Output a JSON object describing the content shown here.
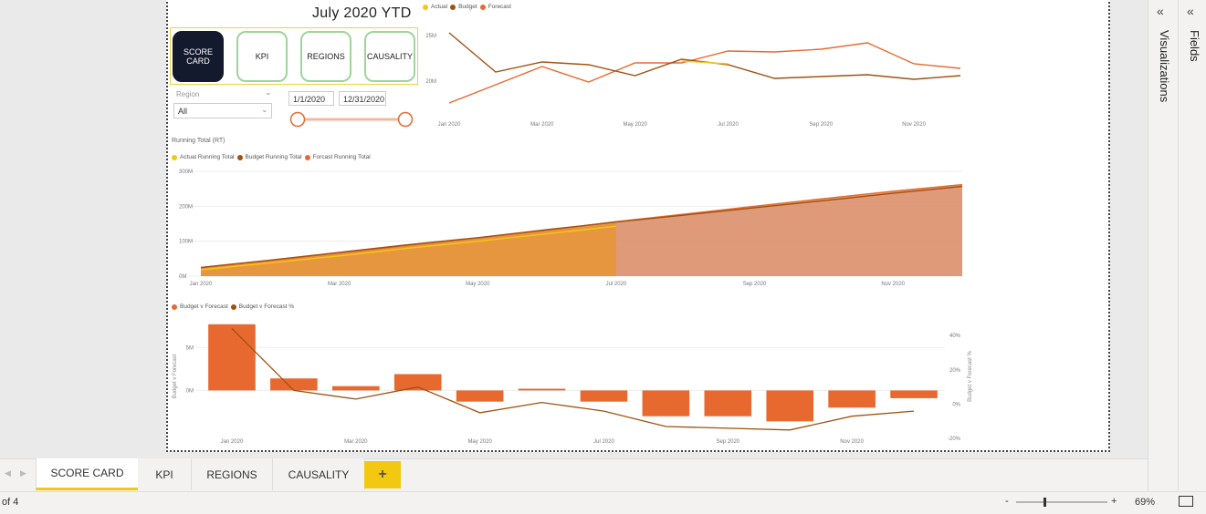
{
  "report": {
    "title": "July 2020 YTD",
    "nav_buttons": [
      {
        "label": "SCORE CARD",
        "active": true
      },
      {
        "label": "KPI",
        "active": false
      },
      {
        "label": "REGIONS",
        "active": false
      },
      {
        "label": "CAUSALITY",
        "active": false
      }
    ],
    "region_slicer": {
      "label": "Region",
      "value": "All"
    },
    "date_slicer": {
      "start": "1/1/2020",
      "end": "12/31/2020"
    }
  },
  "chart_data": [
    {
      "type": "line",
      "legend": [
        "Actual",
        "Budget",
        "Forecast"
      ],
      "x": [
        "Jan 2020",
        "Feb 2020",
        "Mar 2020",
        "Apr 2020",
        "May 2020",
        "Jun 2020",
        "Jul 2020",
        "Aug 2020",
        "Sep 2020",
        "Oct 2020",
        "Nov 2020",
        "Dec 2020"
      ],
      "x_tick_labels": [
        "Jan 2020",
        "Mar 2020",
        "May 2020",
        "Jul 2020",
        "Sep 2020",
        "Nov 2020"
      ],
      "y_tick_labels": [
        "25M",
        "20M"
      ],
      "ylim": [
        17,
        26
      ],
      "series": [
        {
          "name": "Actual",
          "color": "#f2c811",
          "values": [
            null,
            null,
            null,
            null,
            null,
            22.2,
            21.9,
            null,
            null,
            null,
            null,
            null
          ]
        },
        {
          "name": "Budget",
          "color": "#a0520e",
          "values": [
            25.3,
            21.0,
            22.1,
            21.8,
            20.6,
            22.4,
            21.8,
            20.3,
            20.5,
            20.7,
            20.2,
            20.6
          ]
        },
        {
          "name": "Forecast",
          "color": "#e8692f",
          "values": [
            17.6,
            19.6,
            21.6,
            19.9,
            22.0,
            22.0,
            23.3,
            23.2,
            23.5,
            24.2,
            21.9,
            21.4
          ]
        }
      ]
    },
    {
      "type": "area",
      "title": "Running Total  (RT)",
      "legend": [
        "Actual Running Total",
        "Budget Running Total",
        "Forcast Running Total"
      ],
      "x": [
        "Jan 2020",
        "Feb 2020",
        "Mar 2020",
        "Apr 2020",
        "May 2020",
        "Jun 2020",
        "Jul 2020",
        "Aug 2020",
        "Sep 2020",
        "Oct 2020",
        "Nov 2020",
        "Dec 2020"
      ],
      "x_tick_labels": [
        "Jan 2020",
        "Mar 2020",
        "May 2020",
        "Jul 2020",
        "Sep 2020",
        "Nov 2020"
      ],
      "y_tick_labels": [
        "300M",
        "200M",
        "100M",
        "0M"
      ],
      "ylim": [
        0,
        300
      ],
      "series": [
        {
          "name": "Actual Running Total",
          "color": "#f2c811",
          "values": [
            18,
            38,
            58,
            80,
            100,
            121,
            143,
            null,
            null,
            null,
            null,
            null
          ]
        },
        {
          "name": "Budget Running Total",
          "color": "#a0520e",
          "values": [
            25,
            46,
            68,
            90,
            110,
            133,
            155,
            175,
            196,
            216,
            237,
            257
          ]
        },
        {
          "name": "Forcast Running Total",
          "color": "#e8692f",
          "values": [
            24,
            44,
            66,
            88,
            109,
            131,
            156,
            178,
            200,
            222,
            243,
            262
          ]
        }
      ]
    },
    {
      "type": "bar",
      "legend": [
        "Budget v Forecast",
        "Budget v Forecast %"
      ],
      "x": [
        "Jan 2020",
        "Feb 2020",
        "Mar 2020",
        "Apr 2020",
        "May 2020",
        "Jun 2020",
        "Jul 2020",
        "Aug 2020",
        "Sep 2020",
        "Oct 2020",
        "Nov 2020",
        "Dec 2020"
      ],
      "x_tick_labels": [
        "Jan 2020",
        "Mar 2020",
        "May 2020",
        "Jul 2020",
        "Sep 2020",
        "Nov 2020"
      ],
      "ylabel": "Budget v Forecast",
      "y2label": "Budget v Forecast %",
      "y_tick_labels": [
        "5M",
        "0M"
      ],
      "y2_tick_labels": [
        "40%",
        "20%",
        "0%",
        "-20%"
      ],
      "ylim": [
        -6,
        8
      ],
      "y2lim": [
        -22,
        48
      ],
      "series": [
        {
          "name": "Budget v Forecast",
          "color": "#e8692f",
          "values": [
            7.7,
            1.4,
            0.5,
            1.9,
            -1.3,
            0.2,
            -1.3,
            -3.0,
            -3.0,
            -3.6,
            -2.0,
            -0.9
          ]
        },
        {
          "name": "Budget v Forecast %",
          "color": "#a0520e",
          "values": [
            44,
            8,
            3,
            10,
            -5,
            1,
            -4,
            -13,
            -14,
            -15,
            -7,
            -4
          ]
        }
      ]
    }
  ],
  "tabs": [
    {
      "label": "SCORE CARD",
      "active": true
    },
    {
      "label": "KPI",
      "active": false
    },
    {
      "label": "REGIONS",
      "active": false
    },
    {
      "label": "CAUSALITY",
      "active": false
    }
  ],
  "add_tab_label": "+",
  "status": {
    "page_info": "of 4",
    "zoom_minus": "-",
    "zoom_plus": "+",
    "zoom": "69%"
  },
  "panes": {
    "visualizations": "Visualizations",
    "fields": "Fields"
  },
  "colors": {
    "actual": "#f2c811",
    "budget": "#a0520e",
    "forecast": "#e8692f",
    "accent": "#f2c811"
  }
}
